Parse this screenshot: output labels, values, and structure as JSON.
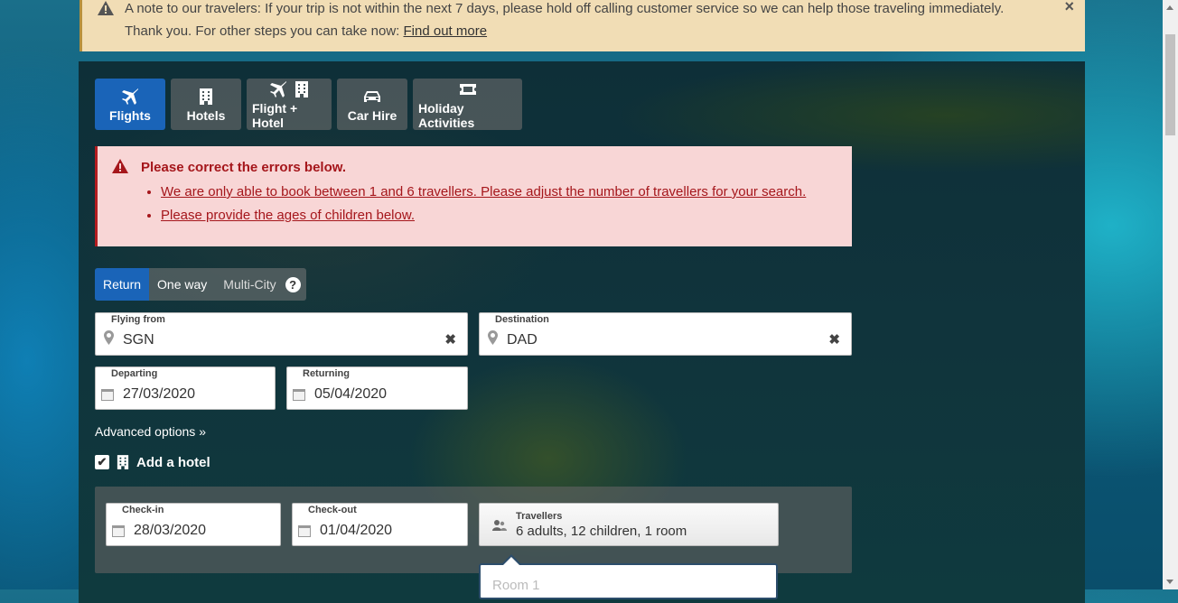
{
  "notice": {
    "text": "A note to our travelers: If your trip is not within the next 7 days, please hold off calling customer service so we can help those traveling immediately. Thank you. For other steps you can take now: ",
    "link": "Find out more",
    "close": "×"
  },
  "tabs": [
    {
      "label": "Flights",
      "icon": "plane-icon",
      "active": true
    },
    {
      "label": "Hotels",
      "icon": "building-icon"
    },
    {
      "label": "Flight + Hotel",
      "icon": "plane-building-icon"
    },
    {
      "label": "Car Hire",
      "icon": "car-icon"
    },
    {
      "label": "Holiday Activities",
      "icon": "ticket-icon"
    }
  ],
  "errors": {
    "title": "Please correct the errors below.",
    "items": [
      "We are only able to book between 1 and 6 travellers. Please adjust the number of travellers for your search.",
      "Please provide the ages of children below."
    ]
  },
  "trip_type": {
    "options": [
      "Return",
      "One way",
      "Multi-City"
    ],
    "selected": "Return",
    "help": "?"
  },
  "flying_from": {
    "label": "Flying from",
    "value": "SGN"
  },
  "destination": {
    "label": "Destination",
    "value": "DAD"
  },
  "departing": {
    "label": "Departing",
    "value": "27/03/2020"
  },
  "returning": {
    "label": "Returning",
    "value": "05/04/2020"
  },
  "advanced": "Advanced options »",
  "add_hotel": {
    "label": "Add a hotel",
    "checked": true
  },
  "check_in": {
    "label": "Check-in",
    "value": "28/03/2020"
  },
  "check_out": {
    "label": "Check-out",
    "value": "01/04/2020"
  },
  "travellers": {
    "label": "Travellers",
    "value": "6 adults, 12 children, 1 room"
  },
  "room_popup": {
    "label": "Room 1"
  },
  "colors": {
    "accent": "#1a64b8",
    "error": "#a5161b",
    "notice_bg": "#f1ddb5"
  }
}
